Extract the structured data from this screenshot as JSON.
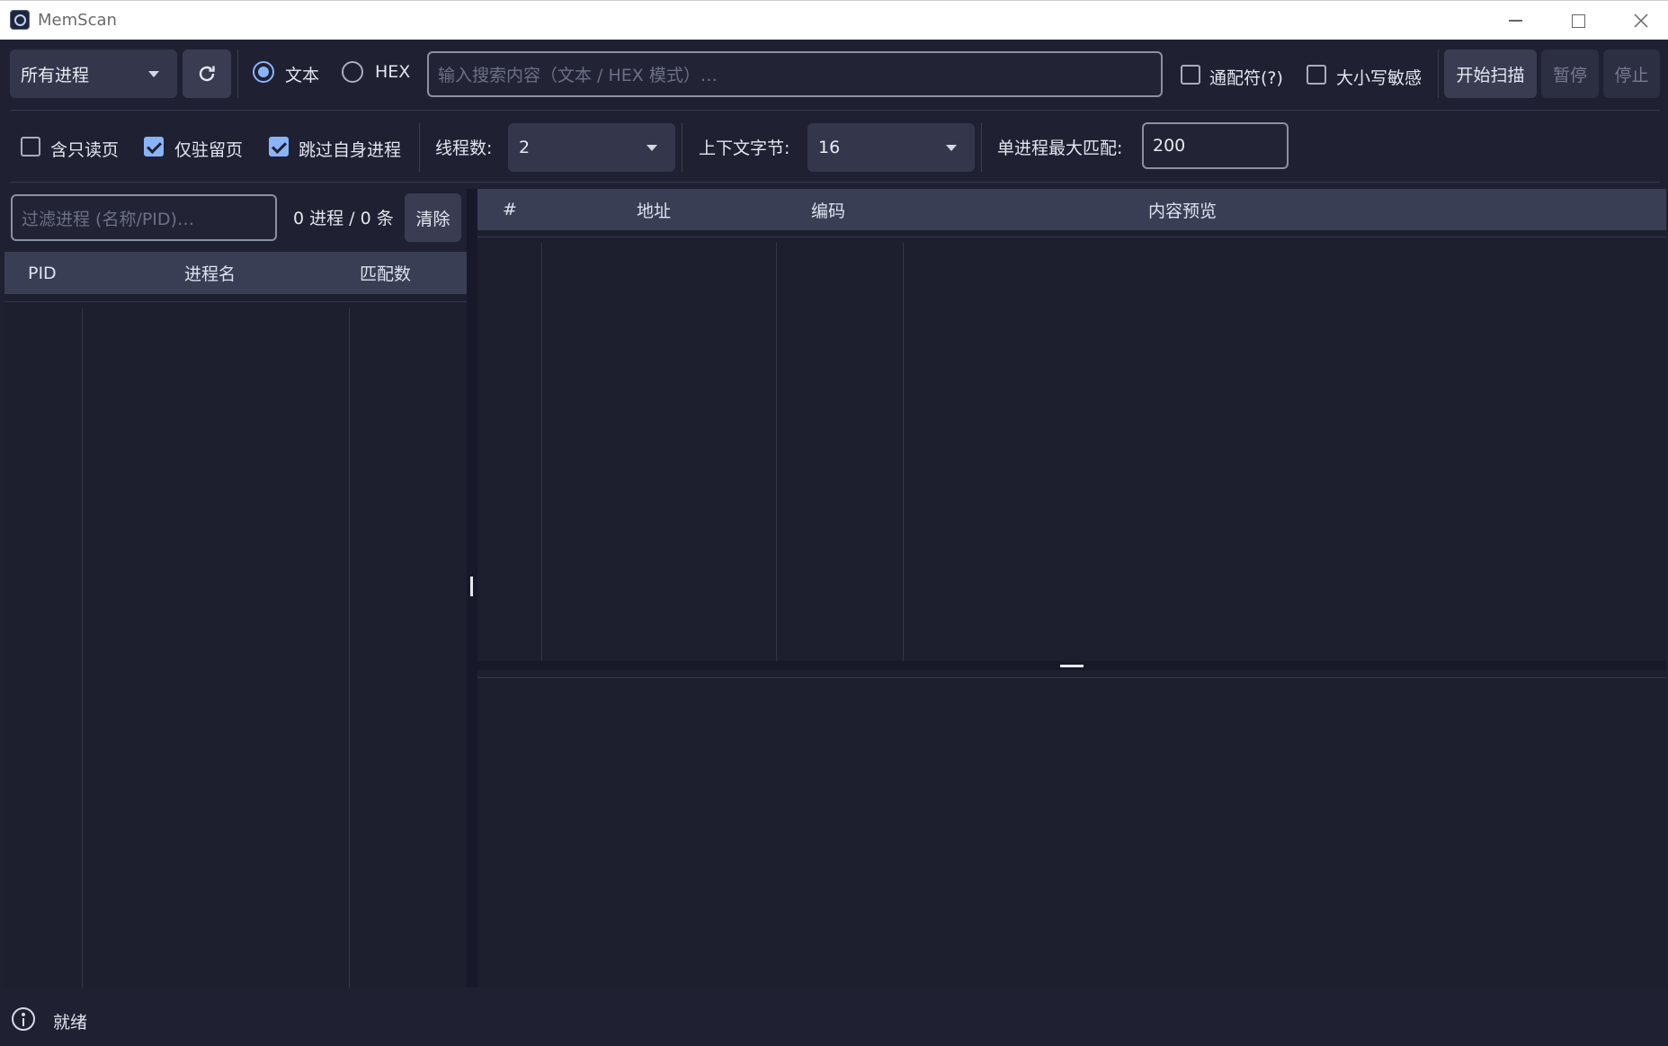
{
  "window": {
    "title": "MemScan"
  },
  "toolbar": {
    "process_select": "所有进程",
    "mode_text_label": "文本",
    "mode_hex_label": "HEX",
    "search_placeholder": "输入搜索内容（文本 / HEX 模式）…",
    "wildcard_label": "通配符(?)",
    "case_sensitive_label": "大小写敏感",
    "start_label": "开始扫描",
    "pause_label": "暂停",
    "stop_label": "停止"
  },
  "options": {
    "readonly_label": "含只读页",
    "resident_label": "仅驻留页",
    "skip_self_label": "跳过自身进程",
    "threads_label": "线程数:",
    "threads_value": "2",
    "context_label": "上下文字节:",
    "context_value": "16",
    "max_match_label": "单进程最大匹配:",
    "max_match_value": "200"
  },
  "process_panel": {
    "filter_placeholder": "过滤进程 (名称/PID)…",
    "summary": "0 进程 / 0 条",
    "clear_label": "清除",
    "columns": [
      "PID",
      "进程名",
      "匹配数"
    ]
  },
  "results_panel": {
    "columns": [
      "#",
      "地址",
      "编码",
      "内容预览"
    ]
  },
  "status": {
    "text": "就绪"
  },
  "state": {
    "mode": "text",
    "wildcard": false,
    "case_sensitive": false,
    "readonly_pages": false,
    "resident_only": true,
    "skip_self": true
  }
}
